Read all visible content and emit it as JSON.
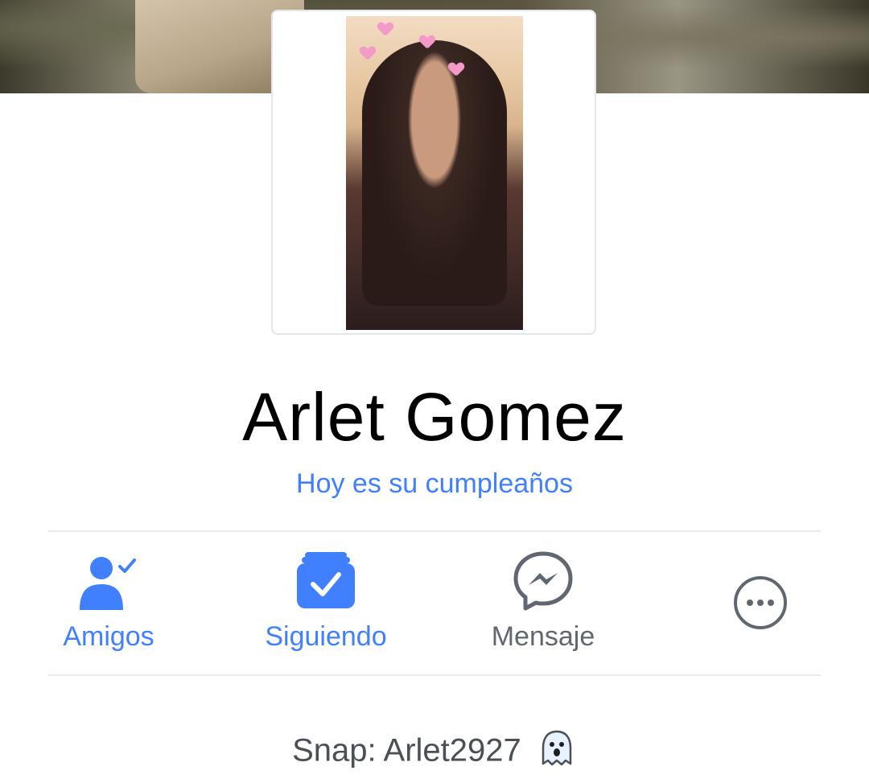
{
  "profile": {
    "name": "Arlet Gomez",
    "birthday_link": "Hoy es su cumpleaños",
    "bio": "Snap: Arlet2927"
  },
  "actions": [
    {
      "label": "Amigos",
      "icon": "friends-check-icon",
      "color": "#4080ff"
    },
    {
      "label": "Siguiendo",
      "icon": "following-check-icon",
      "color": "#4080ff"
    },
    {
      "label": "Mensaje",
      "icon": "messenger-icon",
      "color": "#606770"
    },
    {
      "label": "",
      "icon": "more-options-icon",
      "color": "#606770"
    }
  ],
  "colors": {
    "accent": "#4080ff",
    "muted": "#606770",
    "divider": "#e9eaed"
  }
}
